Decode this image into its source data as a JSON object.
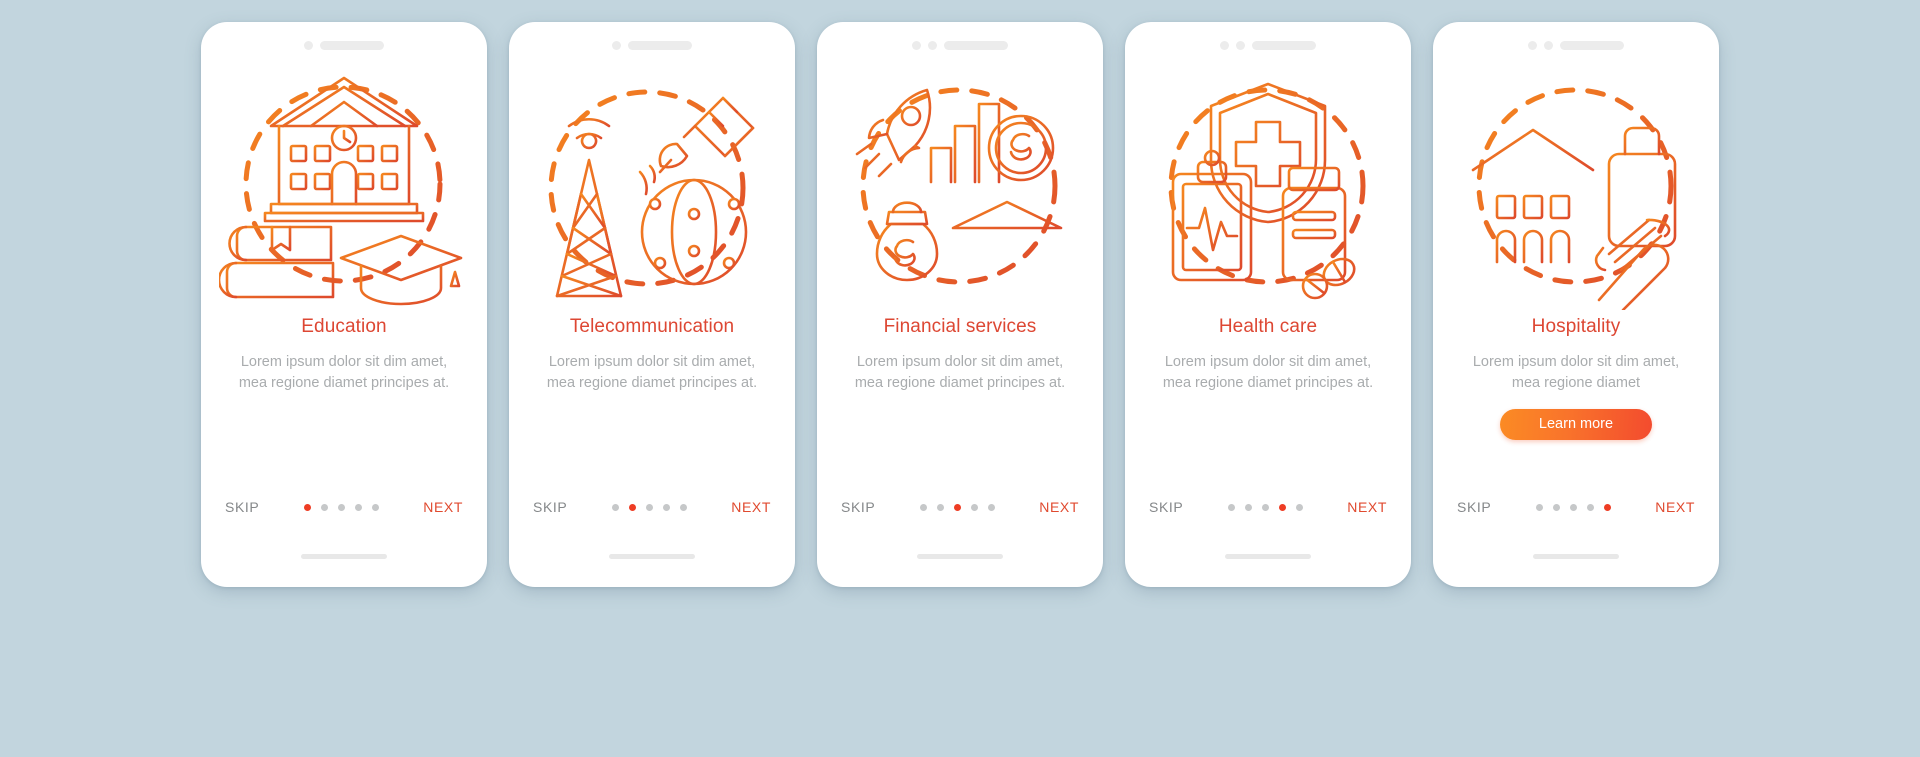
{
  "page": {
    "background_color": "#c2d5de",
    "card_background": "#ffffff",
    "accent_color": "#dd4733",
    "muted_text_color": "#a9acae",
    "dot_active_color": "#ee3d24",
    "dot_inactive_color": "#c6c8c9"
  },
  "common": {
    "skip_label": "SKIP",
    "next_label": "NEXT",
    "body_text": "Lorem ipsum dolor sit dim amet, mea regione diamet principes at.",
    "total_steps": 5
  },
  "screens": [
    {
      "id": "education",
      "title": "Education",
      "body": "Lorem ipsum dolor sit dim amet, mea regione diamet principes at.",
      "skip_label": "SKIP",
      "next_label": "NEXT",
      "active_dot": 1,
      "illustration": "education-illustration",
      "notch_dots": 1,
      "has_learn_more": false
    },
    {
      "id": "telecommunication",
      "title": "Telecommunication",
      "body": "Lorem ipsum dolor sit dim amet, mea regione diamet principes at.",
      "skip_label": "SKIP",
      "next_label": "NEXT",
      "active_dot": 2,
      "illustration": "telecommunication-illustration",
      "notch_dots": 1,
      "has_learn_more": false
    },
    {
      "id": "financial-services",
      "title": "Financial services",
      "body": "Lorem ipsum dolor sit dim amet, mea regione diamet principes at.",
      "skip_label": "SKIP",
      "next_label": "NEXT",
      "active_dot": 3,
      "illustration": "financial-services-illustration",
      "notch_dots": 2,
      "has_learn_more": false
    },
    {
      "id": "health-care",
      "title": "Health care",
      "body": "Lorem ipsum dolor sit dim amet, mea regione diamet principes at.",
      "skip_label": "SKIP",
      "next_label": "NEXT",
      "active_dot": 4,
      "illustration": "health-care-illustration",
      "notch_dots": 2,
      "has_learn_more": false
    },
    {
      "id": "hospitality",
      "title": "Hospitality",
      "body": "Lorem ipsum dolor sit dim amet, mea regione diamet",
      "skip_label": "SKIP",
      "next_label": "NEXT",
      "learn_more_label": "Learn more",
      "active_dot": 5,
      "illustration": "hospitality-illustration",
      "notch_dots": 2,
      "has_learn_more": true
    }
  ]
}
